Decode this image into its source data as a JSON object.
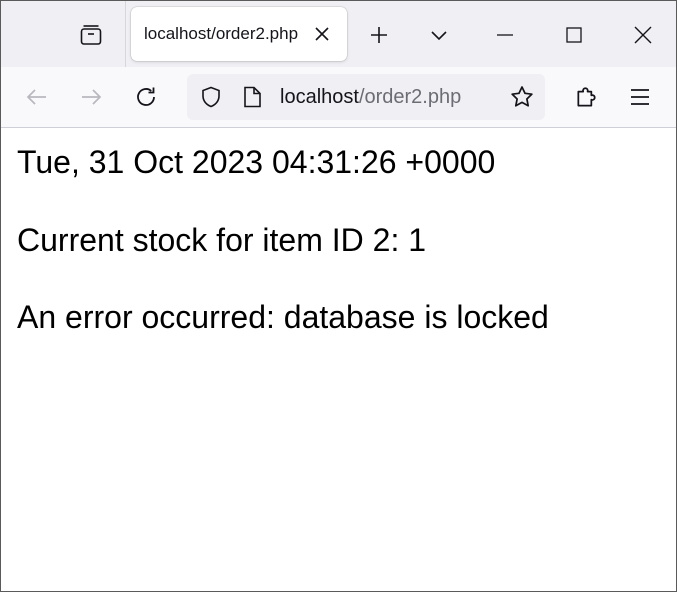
{
  "tab": {
    "title": "localhost/order2.php",
    "close_icon": "close-icon"
  },
  "tab_strip": {
    "tab_list_icon": "tab-list-icon",
    "new_tab_icon": "plus-icon",
    "list_all_tabs_icon": "chevron-down-icon"
  },
  "window_controls": {
    "minimize_icon": "minimize-icon",
    "maximize_icon": "maximize-icon",
    "close_icon": "close-icon"
  },
  "nav": {
    "back_icon": "arrow-left-icon",
    "forward_icon": "arrow-right-icon",
    "reload_icon": "reload-icon",
    "extensions_icon": "puzzle-icon",
    "menu_icon": "hamburger-menu-icon"
  },
  "url_bar": {
    "host": "localhost",
    "path": "/order2.php",
    "shield_icon": "shield-icon",
    "page_icon": "page-icon",
    "bookmark_icon": "star-icon"
  },
  "content": {
    "lines": [
      "Tue, 31 Oct 2023 04:31:26 +0000",
      "Current stock for item ID 2: 1",
      "An error occurred: database is locked"
    ]
  },
  "colors": {
    "tab_strip_bg": "#f0f0f4",
    "nav_bar_bg": "#f9f9fb",
    "url_bar_bg": "#f0f0f4",
    "text": "#15141a",
    "muted_text": "#6c6c74",
    "disabled_icon": "#b8b8be"
  }
}
